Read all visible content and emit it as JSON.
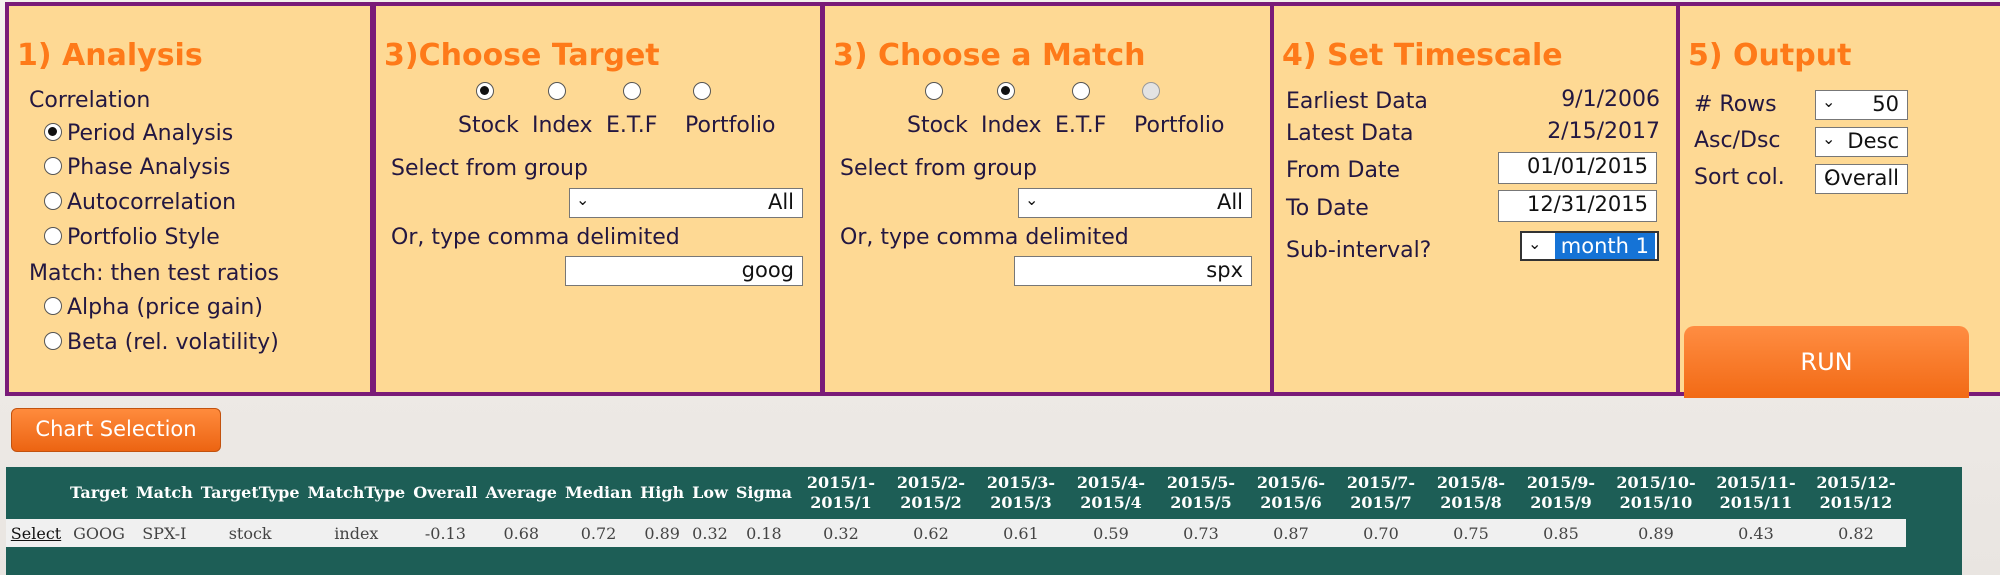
{
  "analysis": {
    "title": "1) Analysis",
    "correlation_label": "Correlation",
    "options": [
      "Period Analysis",
      "Phase Analysis",
      "Autocorrelation",
      "Portfolio Style"
    ],
    "match_label": "Match: then test ratios",
    "ratio_options": [
      "Alpha (price gain)",
      "Beta (rel. volatility)"
    ]
  },
  "target": {
    "title": "3)Choose Target",
    "types": [
      "Stock",
      "Index",
      "E.T.F",
      "Portfolio"
    ],
    "group_label": "Select from group",
    "group_value": "All",
    "comma_label": "Or, type comma delimited",
    "comma_value": "goog"
  },
  "match": {
    "title": "3) Choose a Match",
    "types": [
      "Stock",
      "Index",
      "E.T.F",
      "Portfolio"
    ],
    "group_label": "Select from group",
    "group_value": "All",
    "comma_label": "Or, type comma delimited",
    "comma_value": "spx"
  },
  "timescale": {
    "title": "4) Set Timescale",
    "earliest_label": "Earliest Data",
    "earliest_value": "9/1/2006",
    "latest_label": "Latest Data",
    "latest_value": "2/15/2017",
    "from_label": "From Date",
    "from_value": "01/01/2015",
    "to_label": "To Date",
    "to_value": "12/31/2015",
    "sub_label": "Sub-interval?",
    "sub_value": "month 1"
  },
  "output": {
    "title": "5) Output",
    "rows_label": "# Rows",
    "rows_value": "50",
    "order_label": "Asc/Dsc",
    "order_value": "Desc",
    "sort_label": "Sort col.",
    "sort_value": "Overall",
    "run_label": "RUN"
  },
  "chart_button": "Chart Selection",
  "results": {
    "headers": [
      "",
      "Target",
      "Match",
      "TargetType",
      "MatchType",
      "Overall",
      "Average",
      "Median",
      "High",
      "Low",
      "Sigma",
      "2015/1-\n2015/1",
      "2015/2-\n2015/2",
      "2015/3-\n2015/3",
      "2015/4-\n2015/4",
      "2015/5-\n2015/5",
      "2015/6-\n2015/6",
      "2015/7-\n2015/7",
      "2015/8-\n2015/8",
      "2015/9-\n2015/9",
      "2015/10-\n2015/10",
      "2015/11-\n2015/11",
      "2015/12-\n2015/12"
    ],
    "rows": [
      [
        "Select",
        "GOOG",
        "SPX-I",
        "stock",
        "index",
        "-0.13",
        "0.68",
        "0.72",
        "0.89",
        "0.32",
        "0.18",
        "0.32",
        "0.62",
        "0.61",
        "0.59",
        "0.73",
        "0.87",
        "0.70",
        "0.75",
        "0.85",
        "0.89",
        "0.43",
        "0.82"
      ]
    ]
  }
}
